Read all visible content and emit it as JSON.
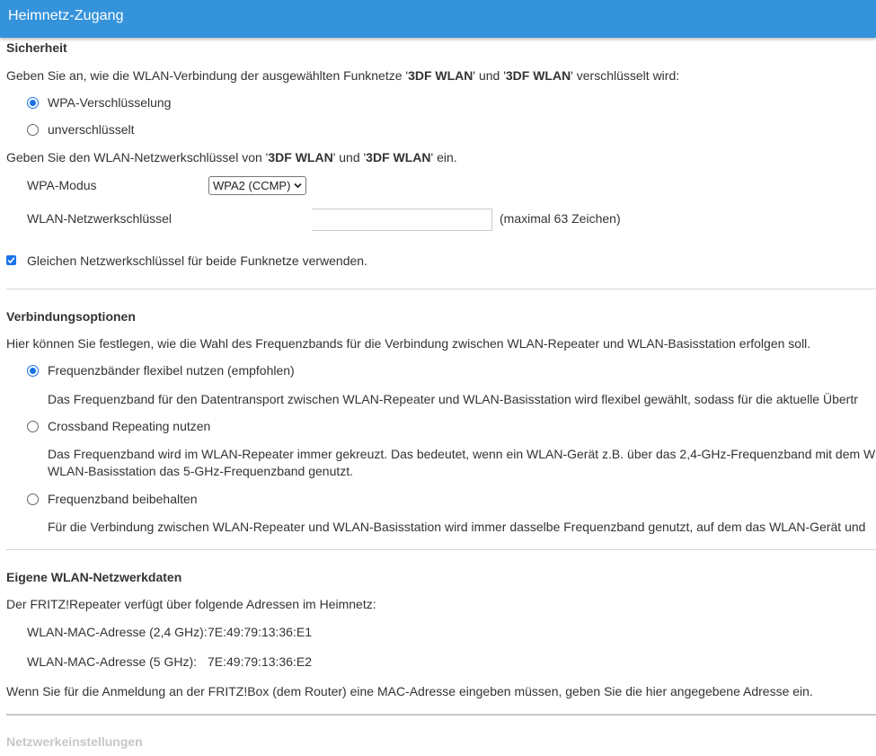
{
  "header": {
    "title": "Heimnetz-Zugang"
  },
  "security": {
    "heading": "Sicherheit",
    "intro_pre": "Geben Sie an, wie die WLAN-Verbindung der ausgewählten Funknetze '",
    "net1": "3DF WLAN",
    "intro_mid": "' und '",
    "net2": "3DF WLAN",
    "intro_post": "' verschlüsselt wird:",
    "options": [
      {
        "label": "WPA-Verschlüsselung",
        "selected": true
      },
      {
        "label": "unverschlüsselt",
        "selected": false
      }
    ],
    "key_pre": "Geben Sie den WLAN-Netzwerkschlüssel von '",
    "key_net1": "3DF WLAN",
    "key_mid": "' und '",
    "key_net2": "3DF WLAN",
    "key_post": "' ein.",
    "wpa_mode_label": "WPA-Modus",
    "wpa_mode_value": "WPA2 (CCMP)",
    "key_label": "WLAN-Netzwerkschlüssel",
    "key_value": "",
    "key_hint": "(maximal 63 Zeichen)",
    "same_key_label": "Gleichen Netzwerkschlüssel für beide Funknetze verwenden.",
    "same_key_checked": true
  },
  "connection": {
    "heading": "Verbindungsoptionen",
    "intro": "Hier können Sie festlegen, wie die Wahl des Frequenzbands für die Verbindung zwischen WLAN-Repeater und WLAN-Basisstation erfolgen soll.",
    "options": [
      {
        "label": "Frequenzbänder flexibel nutzen (empfohlen)",
        "selected": true,
        "desc1": "Das Frequenzband für den Datentransport zwischen WLAN-Repeater und WLAN-Basisstation wird flexibel gewählt, sodass für die aktuelle Übertr",
        "desc2": ""
      },
      {
        "label": "Crossband Repeating nutzen",
        "selected": false,
        "desc1": "Das Frequenzband wird im WLAN-Repeater immer gekreuzt. Das bedeutet, wenn ein WLAN-Gerät z.B. über das 2,4-GHz-Frequenzband mit dem W",
        "desc2": "WLAN-Basisstation das 5-GHz-Frequenzband genutzt."
      },
      {
        "label": "Frequenzband beibehalten",
        "selected": false,
        "desc1": "Für die Verbindung zwischen WLAN-Repeater und WLAN-Basisstation wird immer dasselbe Frequenzband genutzt, auf dem das WLAN-Gerät und",
        "desc2": ""
      }
    ]
  },
  "own_data": {
    "heading": "Eigene WLAN-Netzwerkdaten",
    "intro": "Der FRITZ!Repeater verfügt über folgende Adressen im Heimnetz:",
    "mac24_label": "WLAN-MAC-Adresse (2,4 GHz):",
    "mac24_value": "7E:49:79:13:36:E1",
    "mac5_label": "WLAN-MAC-Adresse (5 GHz):",
    "mac5_value": "7E:49:79:13:36:E2",
    "note": "Wenn Sie für die Anmeldung an der FRITZ!Box (dem Router) eine MAC-Adresse eingeben müssen, geben Sie die hier angegebene Adresse ein."
  },
  "next_section": {
    "heading": "Netzwerkeinstellungen"
  },
  "colors": {
    "header_bg": "#3593dc",
    "accent": "#1a73e8"
  }
}
